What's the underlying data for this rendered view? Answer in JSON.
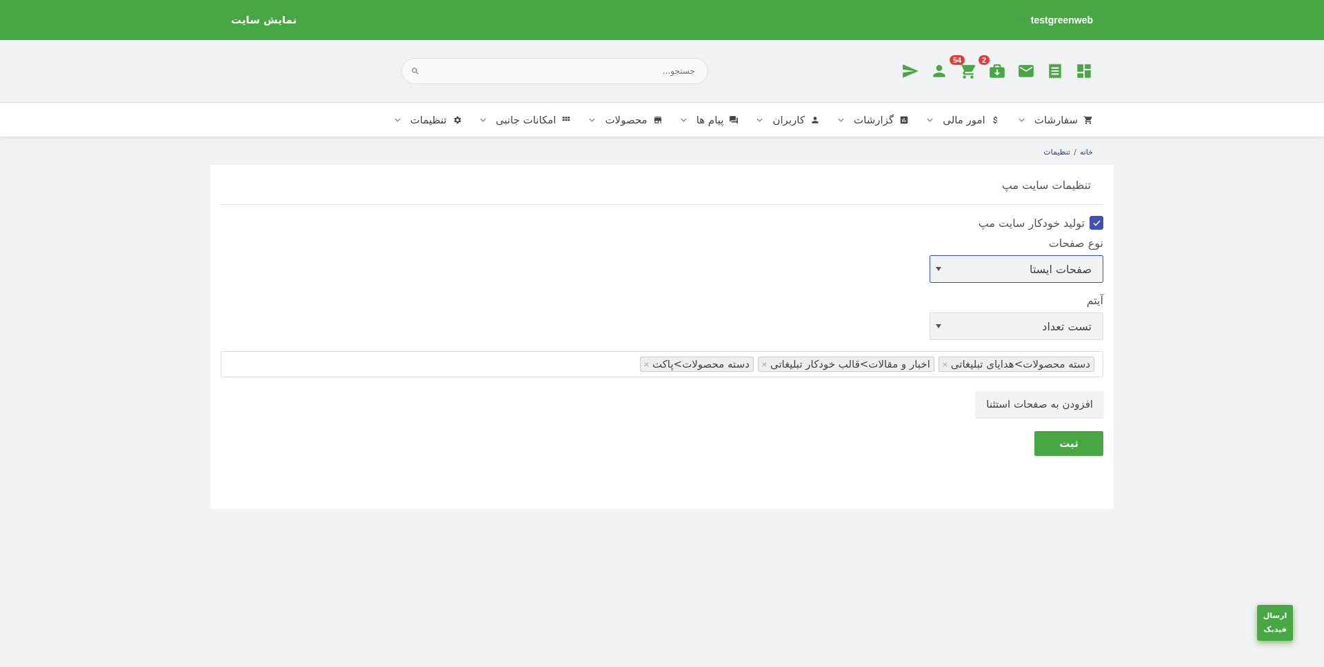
{
  "header": {
    "site_link": "نمایش سایت",
    "user_menu": "testgreenweb"
  },
  "toolbar": {
    "icons": [
      {
        "kind": "dashboard"
      },
      {
        "kind": "receipt"
      },
      {
        "kind": "mail"
      },
      {
        "kind": "download-bag",
        "badge": "2"
      },
      {
        "kind": "cart",
        "badge": "54"
      },
      {
        "kind": "person"
      },
      {
        "kind": "send"
      }
    ],
    "search": {
      "placeholder": "جستجو..."
    }
  },
  "nav": [
    {
      "kind": "cart",
      "label": "سفارشات"
    },
    {
      "kind": "dollar",
      "label": "امور مالی"
    },
    {
      "kind": "chart",
      "label": "گزارشات"
    },
    {
      "kind": "person",
      "label": "کاربران"
    },
    {
      "kind": "chat",
      "label": "پیام ها"
    },
    {
      "kind": "store",
      "label": "محصولات"
    },
    {
      "kind": "grid",
      "label": "امکانات جانبی"
    },
    {
      "kind": "gear",
      "label": "تنظیمات"
    }
  ],
  "breadcrumb": {
    "items": [
      "خانه",
      "تنظیمات"
    ],
    "separator": "/"
  },
  "card": {
    "title": "تنظیمات سایت مپ",
    "auto_generate": {
      "label": "تولید خودکار سایت مپ",
      "checked": true
    },
    "page_type": {
      "label": "نوع صفحات",
      "value": "صفحات ایستا",
      "focused": true
    },
    "item": {
      "label": "آیتم",
      "value": "تست تعداد",
      "focused": false
    },
    "tags": [
      "دسته محصولات>هدایای تبلیغاتی",
      "اخبار و مقالات>قالب خودکار تبلیغاتی",
      "دسته محصولات>پاکت"
    ],
    "add_button": "افزودن به صفحات استثنا",
    "submit_button": "ثبت"
  },
  "feedback_button": "ارسال فیدبک"
}
